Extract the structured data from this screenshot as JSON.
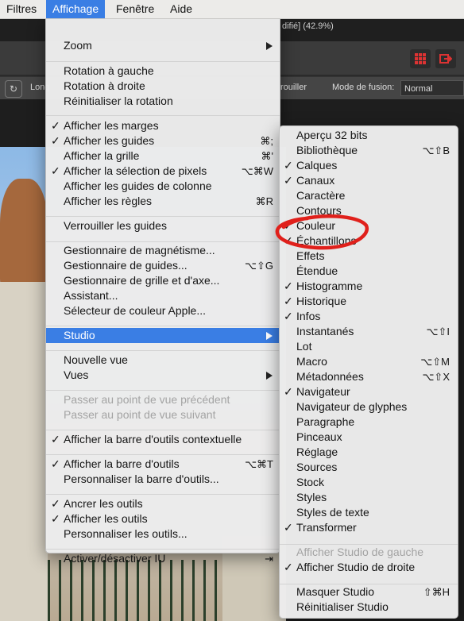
{
  "menubar": [
    {
      "label": "Filtres",
      "active": false
    },
    {
      "label": "Affichage",
      "active": true
    },
    {
      "label": "Fenêtre",
      "active": false
    },
    {
      "label": "Aide",
      "active": false
    }
  ],
  "document": {
    "title_fragment": "difié] (42.9%)"
  },
  "context_toolbar": {
    "long_label": "Long",
    "lock_label": "rouiller",
    "blend_label": "Mode de fusion:",
    "blend_value": "Normal"
  },
  "view_menu": [
    {
      "type": "item",
      "label": "Zoom",
      "submenu": true
    },
    {
      "type": "sep"
    },
    {
      "type": "item",
      "label": "Rotation à gauche"
    },
    {
      "type": "item",
      "label": "Rotation à droite"
    },
    {
      "type": "item",
      "label": "Réinitialiser la rotation"
    },
    {
      "type": "sep"
    },
    {
      "type": "item",
      "label": "Afficher les marges",
      "checked": true
    },
    {
      "type": "item",
      "label": "Afficher les guides",
      "checked": true,
      "shortcut": "⌘;"
    },
    {
      "type": "item",
      "label": "Afficher la grille",
      "shortcut": "⌘'"
    },
    {
      "type": "item",
      "label": "Afficher la sélection de pixels",
      "checked": true,
      "shortcut": "⌥⌘W"
    },
    {
      "type": "item",
      "label": "Afficher les guides de colonne"
    },
    {
      "type": "item",
      "label": "Afficher les règles",
      "shortcut": "⌘R"
    },
    {
      "type": "sep"
    },
    {
      "type": "item",
      "label": "Verrouiller les guides"
    },
    {
      "type": "sep"
    },
    {
      "type": "item",
      "label": "Gestionnaire de magnétisme..."
    },
    {
      "type": "item",
      "label": "Gestionnaire de guides...",
      "shortcut": "⌥⇧G"
    },
    {
      "type": "item",
      "label": "Gestionnaire de grille et d'axe..."
    },
    {
      "type": "item",
      "label": "Assistant..."
    },
    {
      "type": "item",
      "label": "Sélecteur de couleur Apple..."
    },
    {
      "type": "sep"
    },
    {
      "type": "item",
      "label": "Studio",
      "submenu": true,
      "highlighted": true
    },
    {
      "type": "sep"
    },
    {
      "type": "item",
      "label": "Nouvelle vue"
    },
    {
      "type": "item",
      "label": "Vues",
      "submenu": true
    },
    {
      "type": "sep"
    },
    {
      "type": "item",
      "label": "Passer au point de vue précédent",
      "disabled": true
    },
    {
      "type": "item",
      "label": "Passer au point de vue suivant",
      "disabled": true
    },
    {
      "type": "sep"
    },
    {
      "type": "item",
      "label": "Afficher la barre d'outils contextuelle",
      "checked": true
    },
    {
      "type": "sep"
    },
    {
      "type": "item",
      "label": "Afficher la barre d'outils",
      "checked": true,
      "shortcut": "⌥⌘T"
    },
    {
      "type": "item",
      "label": "Personnaliser la barre d'outils..."
    },
    {
      "type": "sep"
    },
    {
      "type": "item",
      "label": "Ancrer les outils",
      "checked": true
    },
    {
      "type": "item",
      "label": "Afficher les outils",
      "checked": true
    },
    {
      "type": "item",
      "label": "Personnaliser les outils..."
    },
    {
      "type": "sep"
    },
    {
      "type": "item",
      "label": "Activer/désactiver IU",
      "shortcut": "⇥"
    }
  ],
  "studio_menu": [
    {
      "type": "item",
      "label": "Aperçu 32 bits"
    },
    {
      "type": "item",
      "label": "Bibliothèque",
      "shortcut": "⌥⇧B"
    },
    {
      "type": "item",
      "label": "Calques",
      "checked": true
    },
    {
      "type": "item",
      "label": "Canaux",
      "checked": true
    },
    {
      "type": "item",
      "label": "Caractère"
    },
    {
      "type": "item",
      "label": "Contours"
    },
    {
      "type": "item",
      "label": "Couleur",
      "checked": true
    },
    {
      "type": "item",
      "label": "Échantillons",
      "checked": true
    },
    {
      "type": "item",
      "label": "Effets"
    },
    {
      "type": "item",
      "label": "Étendue"
    },
    {
      "type": "item",
      "label": "Histogramme",
      "checked": true
    },
    {
      "type": "item",
      "label": "Historique",
      "checked": true
    },
    {
      "type": "item",
      "label": "Infos",
      "checked": true
    },
    {
      "type": "item",
      "label": "Instantanés",
      "shortcut": "⌥⇧I"
    },
    {
      "type": "item",
      "label": "Lot"
    },
    {
      "type": "item",
      "label": "Macro",
      "shortcut": "⌥⇧M"
    },
    {
      "type": "item",
      "label": "Métadonnées",
      "shortcut": "⌥⇧X"
    },
    {
      "type": "item",
      "label": "Navigateur",
      "checked": true
    },
    {
      "type": "item",
      "label": "Navigateur de glyphes"
    },
    {
      "type": "item",
      "label": "Paragraphe"
    },
    {
      "type": "item",
      "label": "Pinceaux"
    },
    {
      "type": "item",
      "label": "Réglage"
    },
    {
      "type": "item",
      "label": "Sources"
    },
    {
      "type": "item",
      "label": "Stock"
    },
    {
      "type": "item",
      "label": "Styles"
    },
    {
      "type": "item",
      "label": "Styles de texte"
    },
    {
      "type": "item",
      "label": "Transformer",
      "checked": true
    },
    {
      "type": "sep"
    },
    {
      "type": "item",
      "label": "Afficher Studio de gauche",
      "disabled": true
    },
    {
      "type": "item",
      "label": "Afficher Studio de droite",
      "checked": true
    },
    {
      "type": "sep"
    },
    {
      "type": "item",
      "label": "Masquer Studio",
      "shortcut": "⇧⌘H"
    },
    {
      "type": "item",
      "label": "Réinitialiser Studio"
    }
  ],
  "annotation": {
    "color": "#e0201b",
    "shape": "hand-drawn-ellipse"
  }
}
